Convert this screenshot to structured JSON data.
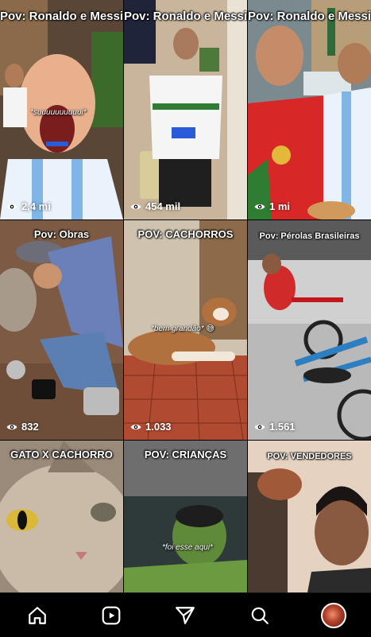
{
  "tiles": [
    {
      "caption": "Pov: Ronaldo e Messi",
      "bubble": "*suuuuuuuuuui*",
      "views": "2,4 mi"
    },
    {
      "caption": "Pov: Ronaldo e Messi",
      "views": "454 mil"
    },
    {
      "caption": "Pov: Ronaldo e Messi",
      "views": "1 mi"
    },
    {
      "caption": "Pov: Obras",
      "views": "832"
    },
    {
      "caption": "POV: CACHORROS",
      "bubble": "*bem grandão* 😅",
      "views": "1.033"
    },
    {
      "caption": "Pov: Pérolas Brasileiras",
      "views": "1.561"
    },
    {
      "caption": "GATO X CACHORRO"
    },
    {
      "caption": "POV: CRIANÇAS",
      "bubble": "*foi esse aqui*"
    },
    {
      "caption": "POV: VENDEDORES"
    }
  ],
  "nav": {
    "items": [
      "home-icon",
      "reels-icon",
      "direct-send-icon",
      "search-icon",
      "profile-avatar"
    ]
  },
  "colors": {
    "background": "#000000",
    "text": "#ffffff"
  }
}
